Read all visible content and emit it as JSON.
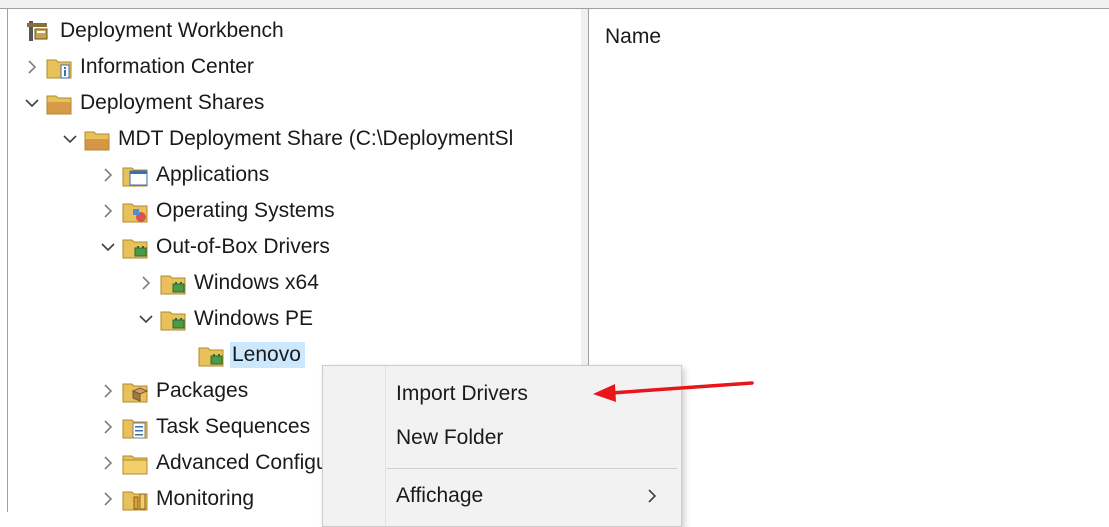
{
  "tree": {
    "items": [
      {
        "label": "Deployment Workbench",
        "icon": "workbench-icon"
      },
      {
        "label": "Information Center",
        "icon": "info-folder-icon"
      },
      {
        "label": "Deployment Shares",
        "icon": "folder-icon"
      },
      {
        "label": "MDT Deployment Share (C:\\DeploymentSl",
        "icon": "share-folder-icon"
      },
      {
        "label": "Applications",
        "icon": "applications-icon"
      },
      {
        "label": "Operating Systems",
        "icon": "os-folder-icon"
      },
      {
        "label": "Out-of-Box Drivers",
        "icon": "drivers-folder-icon"
      },
      {
        "label": "Windows x64",
        "icon": "drivers-folder-icon"
      },
      {
        "label": "Windows PE",
        "icon": "drivers-folder-icon"
      },
      {
        "label": "Lenovo",
        "icon": "drivers-folder-icon"
      },
      {
        "label": "Packages",
        "icon": "packages-icon"
      },
      {
        "label": "Task Sequences",
        "icon": "task-sequence-icon"
      },
      {
        "label": "Advanced Configuration",
        "icon": "folder-icon"
      },
      {
        "label": "Monitoring",
        "icon": "monitoring-icon"
      }
    ]
  },
  "list": {
    "column_header": "Name"
  },
  "context_menu": {
    "items": [
      {
        "label": "Import Drivers"
      },
      {
        "label": "New Folder"
      },
      {
        "label": "Affichage"
      }
    ]
  },
  "colors": {
    "selection": "#cce8ff",
    "annotation_arrow": "#e8161b",
    "folder": "#e9c15a"
  }
}
